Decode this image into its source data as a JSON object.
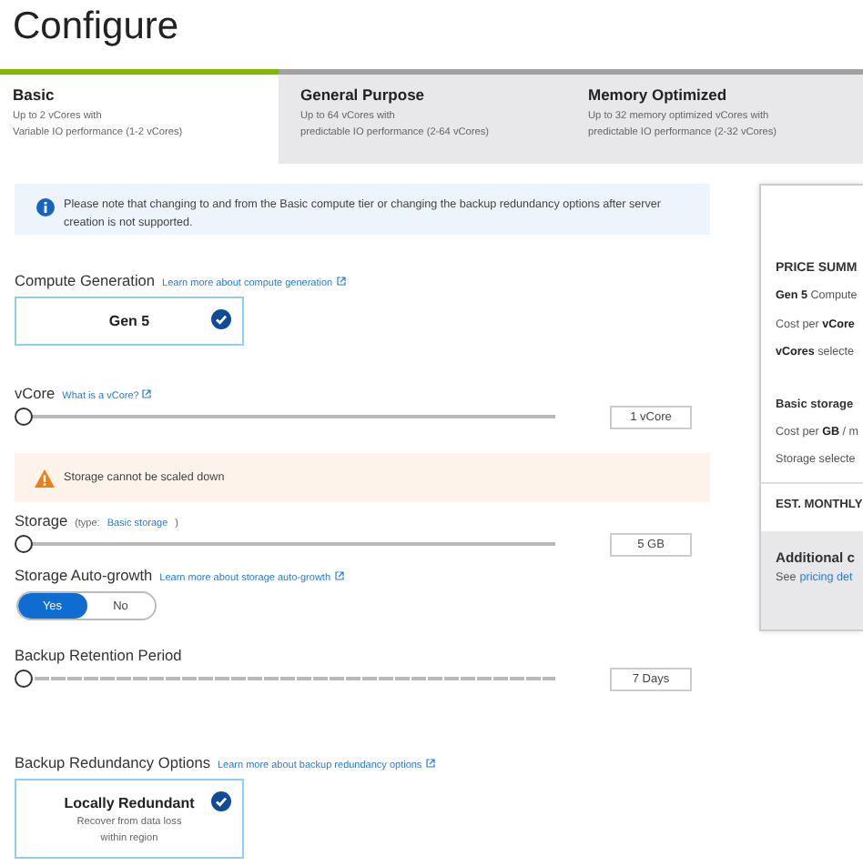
{
  "title": "Configure",
  "tabs": [
    {
      "label": "Basic",
      "description": "Up to 2 vCores with\nVariable IO performance (1-2 vCores)",
      "selected": true
    },
    {
      "label": "General Purpose",
      "description": "Up to 64 vCores with\npredictable IO performance (2-64 vCores)",
      "selected": false
    },
    {
      "label": "Memory Optimized",
      "description": "Up to 32 memory optimized vCores with\npredictable IO performance (2-32 vCores)",
      "selected": false
    }
  ],
  "info_note": "Please note that changing to and from the Basic compute tier or changing the backup redundancy options after server creation is not supported.",
  "compute_generation": {
    "label": "Compute Generation",
    "link": "Learn more about compute generation",
    "option": {
      "title": "Gen 5",
      "checked": true
    }
  },
  "vcore": {
    "label": "vCore",
    "link": "What is a vCore?",
    "level": 0,
    "value": "1 vCore"
  },
  "storage_warning": "Storage cannot be scaled down",
  "storage": {
    "label": "Storage",
    "type_label": "(type:",
    "type_value": "Basic storage",
    "type_close": ")",
    "level": 0,
    "value": "5 GB"
  },
  "auto_growth": {
    "label": "Storage Auto-growth",
    "link": "Learn more about storage auto-growth",
    "options": [
      {
        "label": "Yes",
        "selected": true
      },
      {
        "label": "No",
        "selected": false
      }
    ]
  },
  "backup_retention": {
    "label": "Backup Retention Period",
    "level": 0,
    "value": "7 Days"
  },
  "backup_redundancy": {
    "label": "Backup Redundancy Options",
    "link": "Learn more about backup redundancy options",
    "option": {
      "title": "Locally Redundant",
      "description": "Recover from data loss\nwithin region",
      "checked": true
    }
  },
  "price_summary": {
    "heading": "PRICE SUMM",
    "compute_lines": [
      "**Gen 5** Compute",
      "Cost per **vCore**",
      "**vCores** selecte"
    ],
    "storage_title": "Basic storage",
    "storage_lines": [
      "Cost per **GB** / m",
      "Storage selecte"
    ],
    "estimate": "EST. MONTHLY",
    "additional_title": "Additional c",
    "see_text": "See",
    "see_link": "pricing det"
  }
}
